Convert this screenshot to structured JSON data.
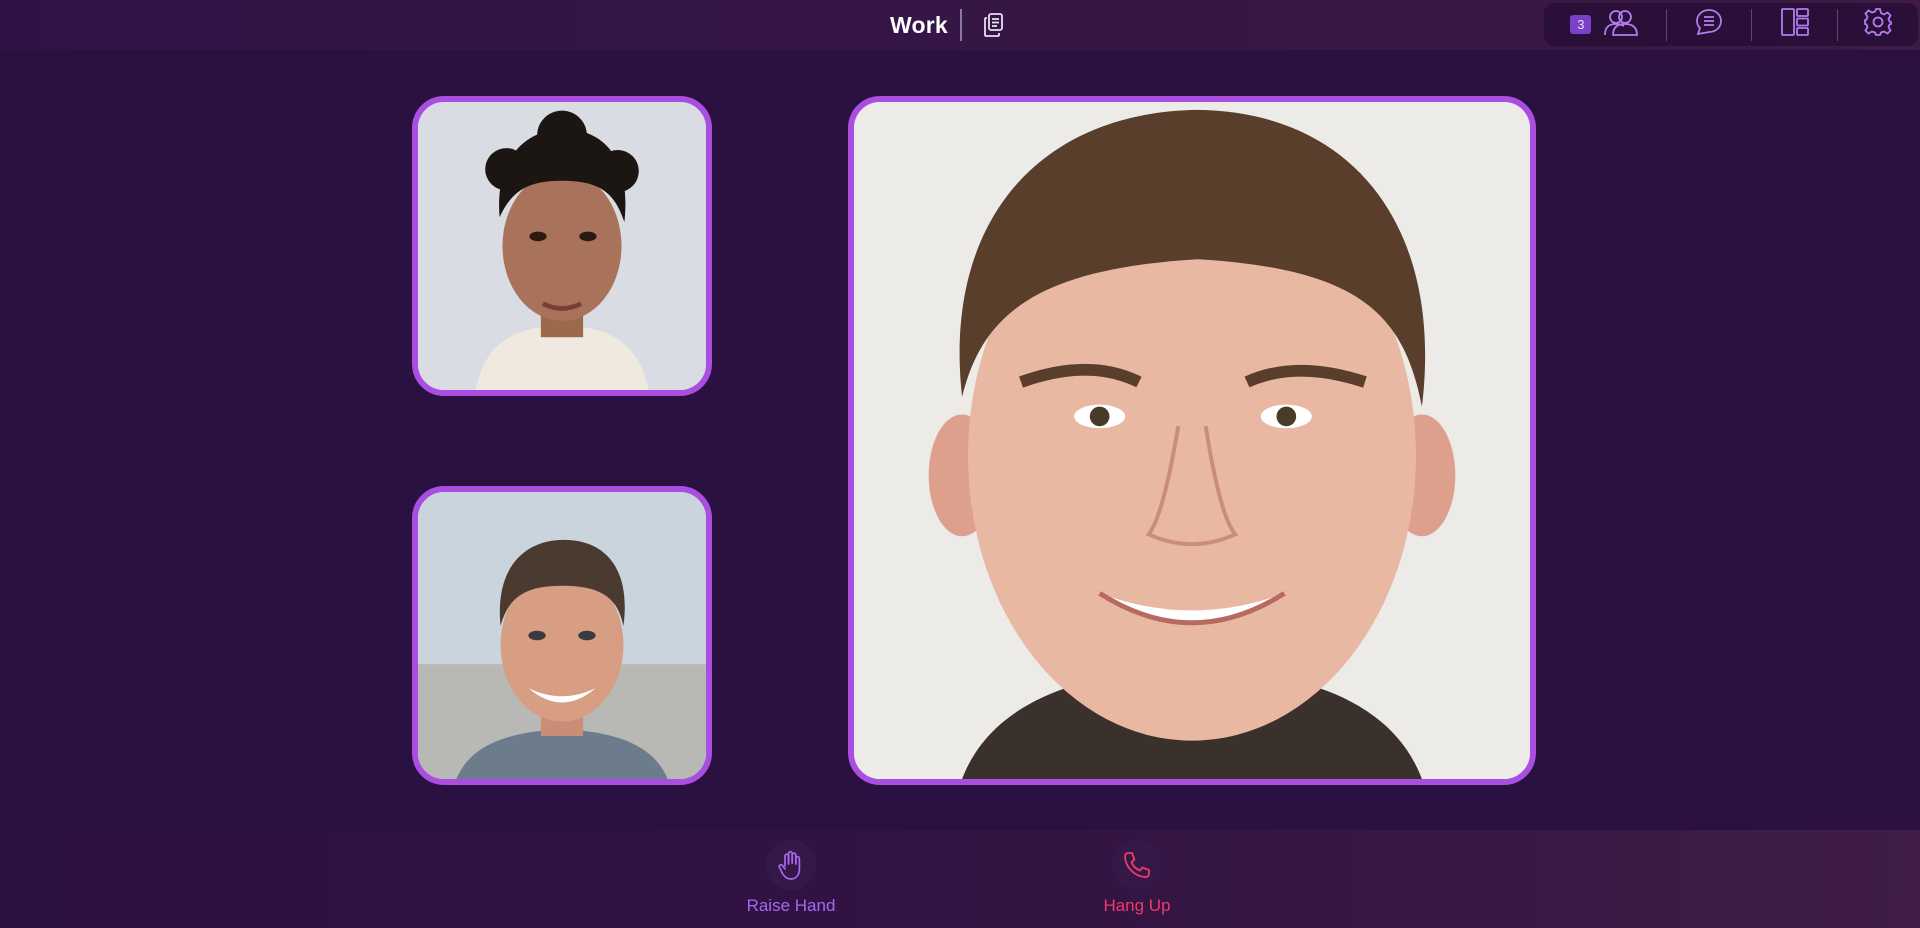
{
  "header": {
    "room_title": "Work",
    "copy_icon": "copy-document-icon"
  },
  "toolbar": {
    "participant_count": "3",
    "items": [
      {
        "icon": "participants-icon"
      },
      {
        "icon": "chat-icon"
      },
      {
        "icon": "layout-icon"
      },
      {
        "icon": "settings-icon"
      }
    ]
  },
  "participants": [
    {
      "tile": "small-top"
    },
    {
      "tile": "small-bottom"
    },
    {
      "tile": "main-speaker"
    }
  ],
  "actions": [
    {
      "label": "Raise Hand",
      "icon": "raise-hand-icon",
      "color": "#a768f0"
    },
    {
      "label": "Hang Up",
      "icon": "hang-up-phone-icon",
      "color": "#f03a6a"
    }
  ],
  "colors": {
    "background": "#2b1042",
    "accent": "#a94ee0",
    "danger": "#f03a6a"
  }
}
